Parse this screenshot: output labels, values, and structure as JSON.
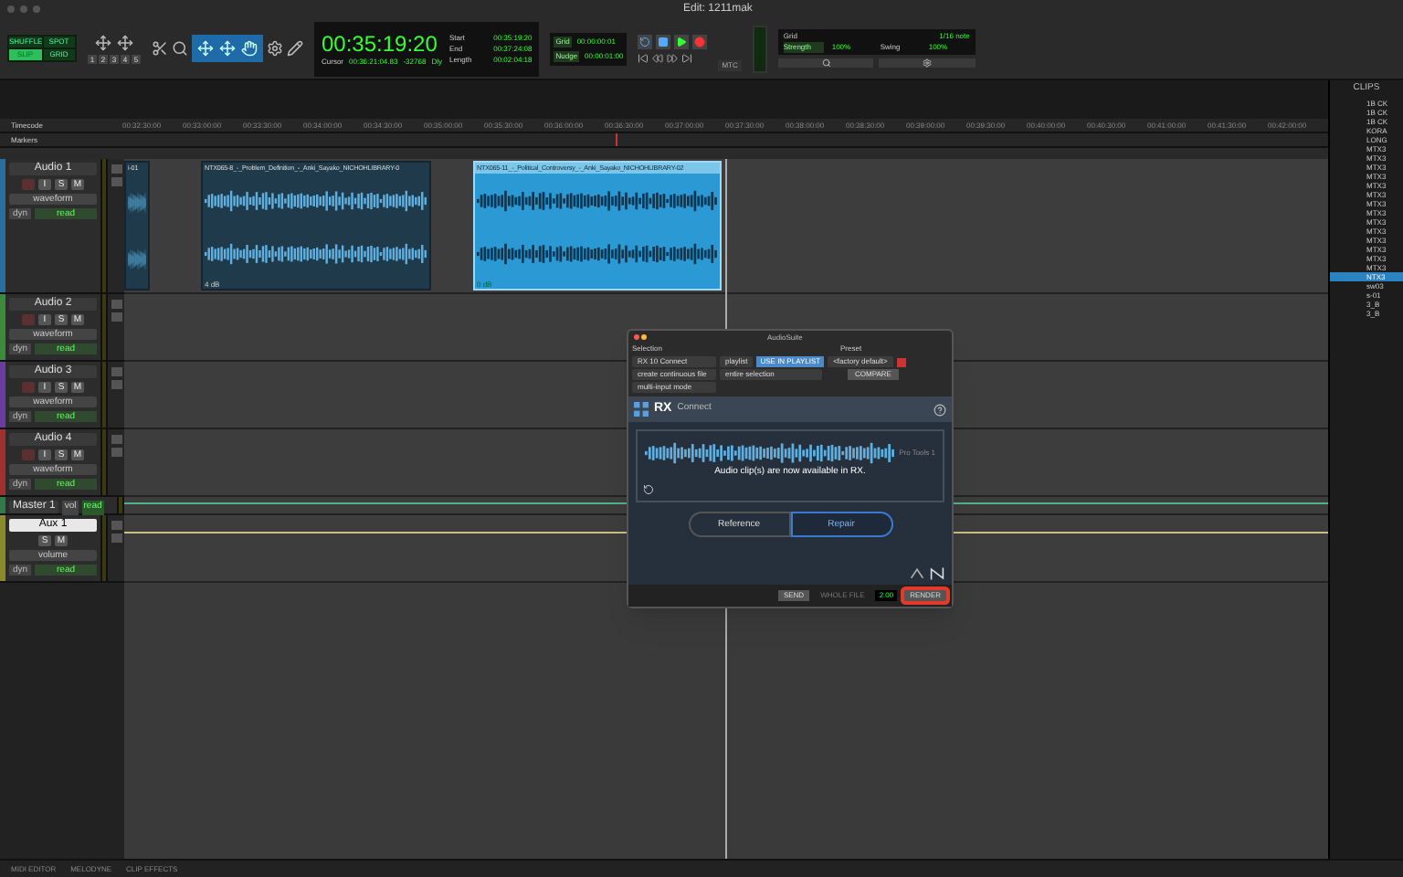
{
  "window": {
    "title": "Edit: 1211mak"
  },
  "edit_modes": [
    {
      "label": "SHUFFLE",
      "selected": false
    },
    {
      "label": "SPOT",
      "selected": false
    },
    {
      "label": "SLIP",
      "selected": true
    },
    {
      "label": "GRID",
      "selected": false
    }
  ],
  "zoom_presets": [
    "1",
    "2",
    "3",
    "4",
    "5"
  ],
  "counter": {
    "main": "00:35:19:20",
    "cursor_label": "Cursor",
    "cursor": "00:36:21:04.83",
    "sample": "-32768",
    "dly": "Dly",
    "start_label": "Start",
    "end_label": "End",
    "length_label": "Length",
    "start": "00:35:19:20",
    "end": "00:37:24:08",
    "length": "00:02:04:18"
  },
  "grid_nudge": [
    {
      "label": "Grid",
      "value": "00:00:00:01"
    },
    {
      "label": "Nudge",
      "value": "00:00:01:00"
    }
  ],
  "mtc": "MTC",
  "groove": {
    "grid_label": "Grid",
    "note": "1/16 note",
    "strength_label": "Strength",
    "strength": "100%",
    "swing_label": "Swing",
    "swing": "100%"
  },
  "rulers": [
    "Timecode",
    "Markers"
  ],
  "timecode_ticks": [
    "00:32:30:00",
    "00:33:00:00",
    "00:33:30:00",
    "00:34:00:00",
    "00:34:30:00",
    "00:35:00:00",
    "00:35:30:00",
    "00:36:00:00",
    "00:36:30:00",
    "00:37:00:00",
    "00:37:30:00",
    "00:38:00:00",
    "00:38:30:00",
    "00:39:00:00",
    "00:39:30:00",
    "00:40:00:00",
    "00:40:30:00",
    "00:41:00:00",
    "00:41:30:00",
    "00:42:00:00"
  ],
  "tracks": [
    {
      "kind": "audio",
      "name": "Audio 1",
      "color": "#2a6ea0",
      "selected": false,
      "buttons": [
        "I",
        "S",
        "M"
      ],
      "view": "waveform",
      "dyn": "dyn",
      "mode": "read",
      "clips": [
        {
          "name": "i-01",
          "selected": false
        },
        {
          "name": "NTX065-8_-_Problem_Definition_-_Anki_Sayako_NICHOHLIBRARY-0",
          "gain": "4 dB",
          "selected": false
        },
        {
          "name": "NTX065-11_-_Political_Controversy_-_Anki_Sayako_NICHOHLIBRARY-02",
          "gain": "0 dB",
          "selected": true
        }
      ]
    },
    {
      "kind": "audio",
      "name": "Audio 2",
      "color": "#3c8a3c",
      "selected": false,
      "buttons": [
        "I",
        "S",
        "M"
      ],
      "view": "waveform",
      "dyn": "dyn",
      "mode": "read"
    },
    {
      "kind": "audio",
      "name": "Audio 3",
      "color": "#6a3ca0",
      "selected": false,
      "buttons": [
        "I",
        "S",
        "M"
      ],
      "view": "waveform",
      "dyn": "dyn",
      "mode": "read"
    },
    {
      "kind": "audio",
      "name": "Audio 4",
      "color": "#a03030",
      "selected": false,
      "buttons": [
        "I",
        "S",
        "M"
      ],
      "view": "waveform",
      "dyn": "dyn",
      "mode": "read"
    },
    {
      "kind": "master",
      "name": "Master 1",
      "color": "#2e7a4a",
      "selected": false,
      "view": "vol",
      "mode": "read"
    },
    {
      "kind": "aux",
      "name": "Aux 1",
      "color": "#8a8a2a",
      "selected": true,
      "buttons": [
        "S",
        "M"
      ],
      "view": "volume",
      "dyn": "dyn",
      "mode": "read"
    }
  ],
  "audiosuite": {
    "title": "AudioSuite",
    "selection_label": "Selection",
    "preset_label": "Preset",
    "plugin": "RX 10 Connect",
    "target": "playlist",
    "use_in_playlist": "USE IN PLAYLIST",
    "file_mode": "create continuous file",
    "selection_mode": "entire selection",
    "input_mode": "multi-input mode",
    "preset": "<factory default>",
    "compare": "COMPARE",
    "plugin_title": "RX",
    "plugin_subtitle": "Connect",
    "host": "Pro Tools 1",
    "message": "Audio clip(s) are now available in RX.",
    "modes": [
      {
        "label": "Reference",
        "selected": false
      },
      {
        "label": "Repair",
        "selected": true
      }
    ],
    "send": "SEND",
    "whole_file": "WHOLE FILE",
    "handle": "2.00",
    "render": "RENDER"
  },
  "clips_panel": {
    "title": "CLIPS",
    "items": [
      {
        "name": "1B CK",
        "selected": false
      },
      {
        "name": "1B CK",
        "selected": false
      },
      {
        "name": "1B CK",
        "selected": false
      },
      {
        "name": "KORA",
        "selected": false
      },
      {
        "name": "LONG",
        "selected": false
      },
      {
        "name": "MTX3",
        "selected": false
      },
      {
        "name": "MTX3",
        "selected": false
      },
      {
        "name": "MTX3",
        "selected": false
      },
      {
        "name": "MTX3",
        "selected": false
      },
      {
        "name": "MTX3",
        "selected": false
      },
      {
        "name": "MTX3",
        "selected": false
      },
      {
        "name": "MTX3",
        "selected": false
      },
      {
        "name": "MTX3",
        "selected": false
      },
      {
        "name": "MTX3",
        "selected": false
      },
      {
        "name": "MTX3",
        "selected": false
      },
      {
        "name": "MTX3",
        "selected": false
      },
      {
        "name": "MTX3",
        "selected": false
      },
      {
        "name": "MTX3",
        "selected": false
      },
      {
        "name": "MTX3",
        "selected": false
      },
      {
        "name": "NTX3",
        "selected": true
      },
      {
        "name": "sw03",
        "selected": false
      },
      {
        "name": "s-01",
        "selected": false
      },
      {
        "name": "3_B",
        "selected": false
      },
      {
        "name": "3_B",
        "selected": false
      }
    ]
  },
  "bottom_tabs": [
    "MIDI EDITOR",
    "MELODYNE",
    "CLIP EFFECTS"
  ]
}
